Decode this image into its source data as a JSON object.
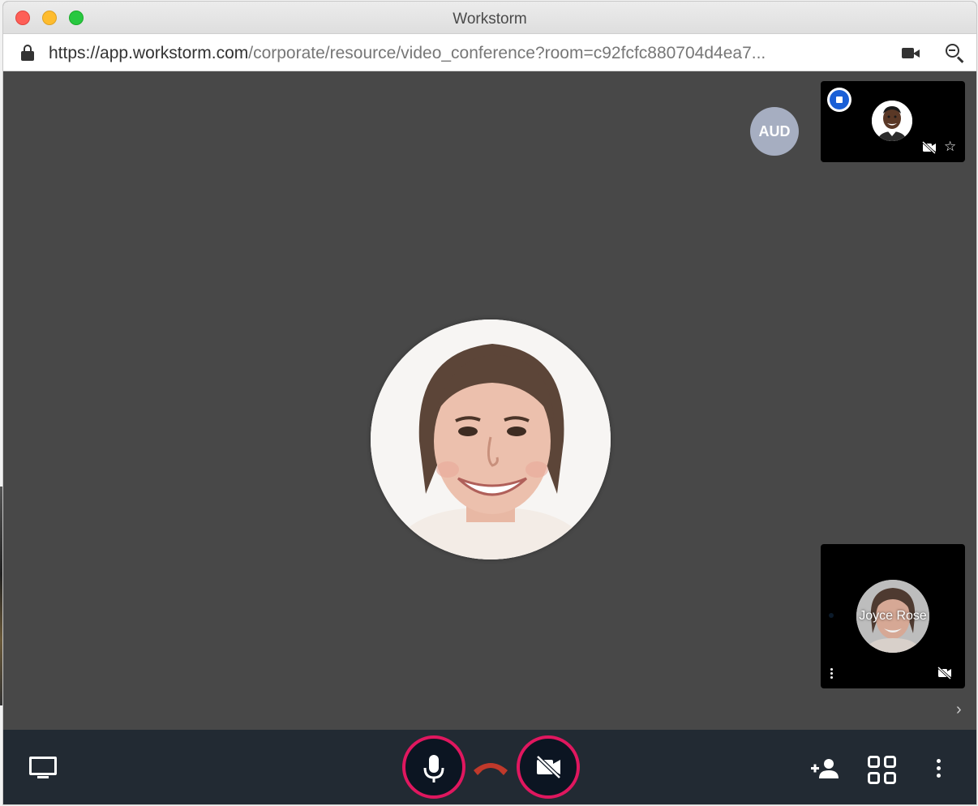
{
  "window": {
    "title": "Workstorm"
  },
  "address_bar": {
    "url_host": "https://app.workstorm.com",
    "url_path": "/corporate/resource/video_conference?room=c92fcfc880704d4ea7..."
  },
  "stage": {
    "main_participant_avatar": "woman-portrait-avatar",
    "audio_badge_label": "AUD",
    "thumbnails": [
      {
        "avatar": "man-portrait-avatar",
        "is_active_speaker": true,
        "camera": "off",
        "pinnable": true
      },
      {
        "avatar": "woman-portrait-avatar",
        "name": "Joyce Rose",
        "camera": "off"
      }
    ]
  },
  "toolbar": {
    "buttons": [
      "screen-share",
      "microphone",
      "hang-up",
      "camera-off",
      "add-participant",
      "grid-view",
      "more-options"
    ]
  },
  "colors": {
    "stage_bg": "#484848",
    "toolbar_bg": "#222a33",
    "highlight_ring": "#e0175f",
    "hangup_red": "#c0392b",
    "speaker_blue": "#1a5fd6",
    "aud_badge": "#a6aec1"
  }
}
